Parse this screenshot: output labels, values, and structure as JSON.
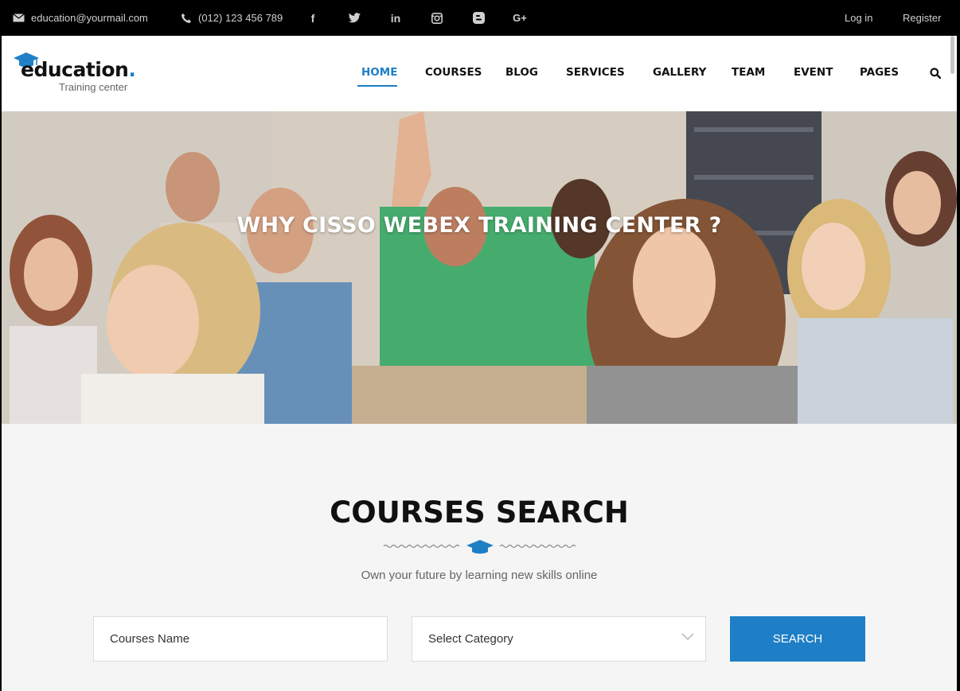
{
  "topbar": {
    "email": "education@yourmail.com",
    "phone": "(012) 123 456 789",
    "social": [
      "facebook-icon",
      "twitter-icon",
      "linkedin-icon",
      "instagram-icon",
      "blogger-icon",
      "google-plus-icon"
    ],
    "social_glyphs": {
      "facebook": "f",
      "linkedin": "in",
      "googleplus": "G+"
    },
    "login_label": "Log in",
    "register_label": "Register"
  },
  "logo": {
    "word": "education",
    "dot": ".",
    "tagline": "Training center"
  },
  "nav": {
    "items": [
      "HOME",
      "COURSES",
      "BLOG",
      "SERVICES",
      "GALLERY",
      "TEAM",
      "EVENT",
      "PAGES"
    ],
    "active": "HOME"
  },
  "hero": {
    "title": "WHY CISSO WEBEX TRAINING CENTER ?"
  },
  "search_section": {
    "title": "COURSES SEARCH",
    "subtitle": "Own your future by learning new skills online",
    "course_name_placeholder": "Courses Name",
    "category_selected": "Select Category",
    "search_label": "SEARCH"
  },
  "colors": {
    "accent": "#1e7fc6",
    "topbar_bg": "#000000",
    "section_bg": "#f5f5f5"
  }
}
